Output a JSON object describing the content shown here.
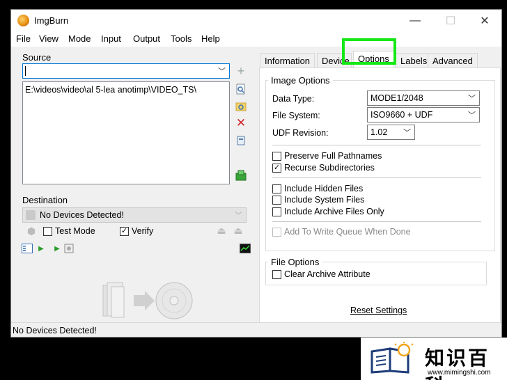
{
  "window": {
    "title": "ImgBurn"
  },
  "titlebar_buttons": {
    "minimize": "—",
    "maximize": "☐",
    "close": "✕"
  },
  "menu": [
    "File",
    "View",
    "Mode",
    "Input",
    "Output",
    "Tools",
    "Help"
  ],
  "source": {
    "label": "Source",
    "input_value": "",
    "list_entry": "E:\\videos\\video\\al 5-lea anotimp\\VIDEO_TS\\"
  },
  "destination": {
    "label": "Destination",
    "device_value": "No Devices Detected!",
    "test_mode_label": "Test Mode",
    "test_mode_checked": false,
    "verify_label": "Verify",
    "verify_checked": true
  },
  "tabs": {
    "information": "Information",
    "device": "Device",
    "options": "Options",
    "labels": "Labels",
    "advanced": "Advanced",
    "active": "Options"
  },
  "image_options": {
    "heading": "Image Options",
    "data_type_label": "Data Type:",
    "data_type_value": "MODE1/2048",
    "file_system_label": "File System:",
    "file_system_value": "ISO9660 + UDF",
    "udf_revision_label": "UDF Revision:",
    "udf_revision_value": "1.02"
  },
  "checkboxes": {
    "preserve_full_pathnames": {
      "label": "Preserve Full Pathnames",
      "checked": false
    },
    "recurse_subdirectories": {
      "label": "Recurse Subdirectories",
      "checked": true
    },
    "include_hidden_files": {
      "label": "Include Hidden Files",
      "checked": false
    },
    "include_system_files": {
      "label": "Include System Files",
      "checked": false
    },
    "include_archive_files_only": {
      "label": "Include Archive Files Only",
      "checked": false
    },
    "add_to_write_queue": {
      "label": "Add To Write Queue When Done",
      "checked": false,
      "disabled": true
    }
  },
  "file_options": {
    "heading": "File Options",
    "clear_archive_attribute": {
      "label": "Clear Archive Attribute",
      "checked": false
    }
  },
  "reset_settings": "Reset Settings",
  "status": "No Devices Detected!",
  "watermark": {
    "cn": "知识百科",
    "url": "www.mimingshi.com"
  },
  "colors": {
    "highlight": "#16e816",
    "accent_green": "#2e9e2e",
    "delete_red": "#d4232b"
  }
}
